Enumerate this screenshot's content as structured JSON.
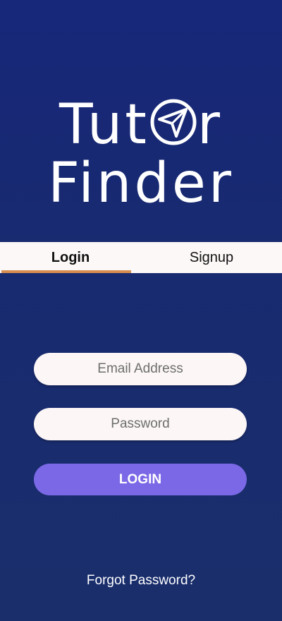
{
  "app": {
    "logo_line1": "Tut",
    "logo_line1_end": "r",
    "logo_line2": "Finder",
    "logo_icon": "compass-arrow-icon"
  },
  "tabs": [
    {
      "label": "Login",
      "active": true
    },
    {
      "label": "Signup",
      "active": false
    }
  ],
  "form": {
    "email_placeholder": "Email Address",
    "email_value": "",
    "password_placeholder": "Password",
    "password_value": "",
    "login_label": "LOGIN",
    "forgot_label": "Forgot Password?"
  },
  "colors": {
    "background": "#17277a",
    "tab_bar": "#fdf8f8",
    "tab_indicator": "#d58e4f",
    "input_bg": "#fcf6f6",
    "login_button": "#7b68e6",
    "text_light": "#ffffff"
  }
}
